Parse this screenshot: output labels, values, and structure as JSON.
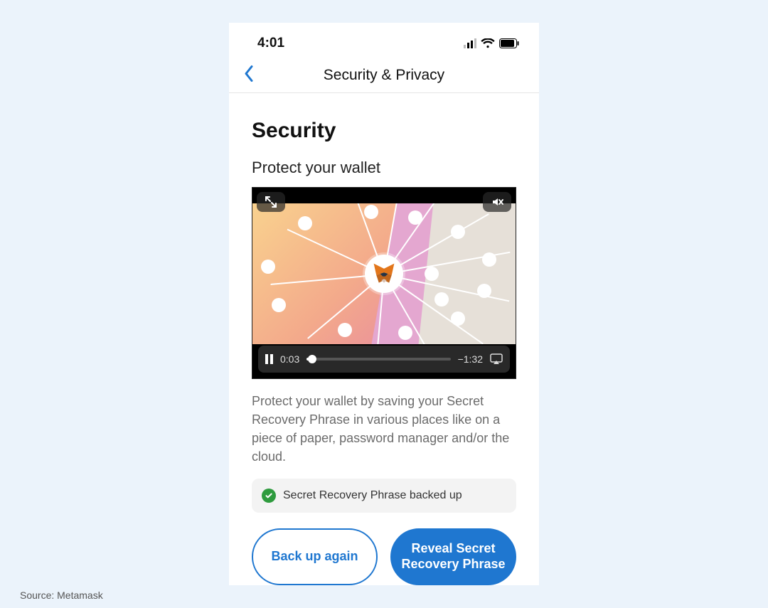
{
  "statusbar": {
    "time": "4:01"
  },
  "navbar": {
    "title": "Security & Privacy"
  },
  "page": {
    "heading": "Security",
    "subheading": "Protect your wallet"
  },
  "video": {
    "elapsed": "0:03",
    "remaining": "−1:32"
  },
  "description": "Protect your wallet by saving your Secret Recovery Phrase in various places like on a piece of paper, password manager and/or the cloud.",
  "backup_status": {
    "text": "Secret Recovery Phrase backed up"
  },
  "buttons": {
    "backup_again": "Back up again",
    "reveal_phrase": "Reveal Secret Recovery Phrase"
  },
  "caption": "Source: Metamask"
}
